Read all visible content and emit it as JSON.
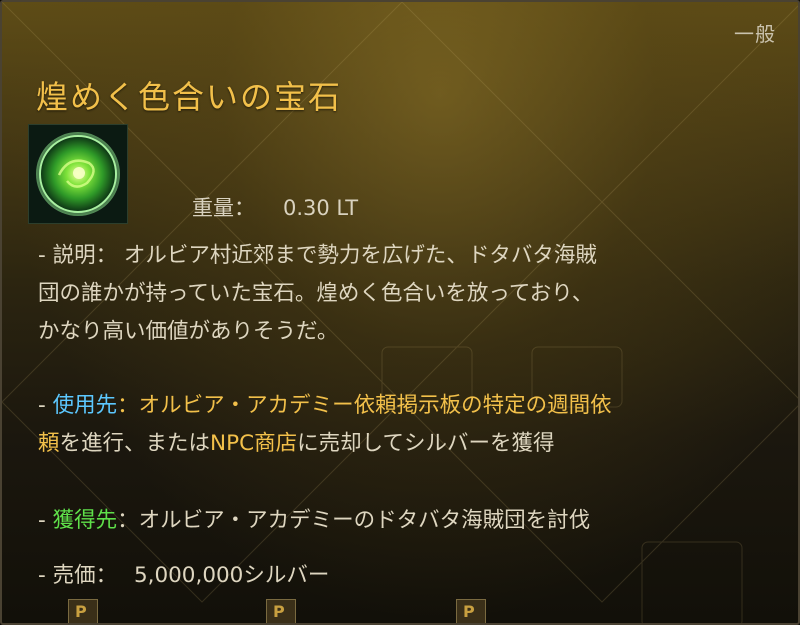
{
  "tooltip": {
    "grade": "一般",
    "item_name": "煌めく色合いの宝石",
    "icon": "glowing-green-gem-icon",
    "weight_label": "重量：",
    "weight_value": "0.30 LT",
    "description_lines": [
      "- 説明： オルビア村近郊まで勢力を広げた、ドタバタ海賊",
      "団の誰かが持っていた宝石。煌めく色合いを放っており、",
      "かなり高い価値がありそうだ。"
    ],
    "usage": {
      "dash": "- ",
      "label": "使用先",
      "sep": "：",
      "line1_highlight": "オルビア・アカデミー依頼掲示板の特定の週間依",
      "line2_highlight": "頼",
      "line2_mid": "を進行、または",
      "line2_highlight2": "NPC商店",
      "line2_rest": "に売却してシルバーを獲得"
    },
    "obtain": {
      "dash": "- ",
      "label": "獲得先",
      "text": "：オルビア・アカデミーのドタバタ海賊団を討伐"
    },
    "price": {
      "label": "- 売価：",
      "value": "5,000,000シルバー"
    },
    "bottom_slot_letter": "P"
  },
  "colors": {
    "title": "#f2c04a",
    "usage_label": "#5cc8ff",
    "obtain_label": "#5fe04a",
    "body_text": "#ded6c0"
  }
}
